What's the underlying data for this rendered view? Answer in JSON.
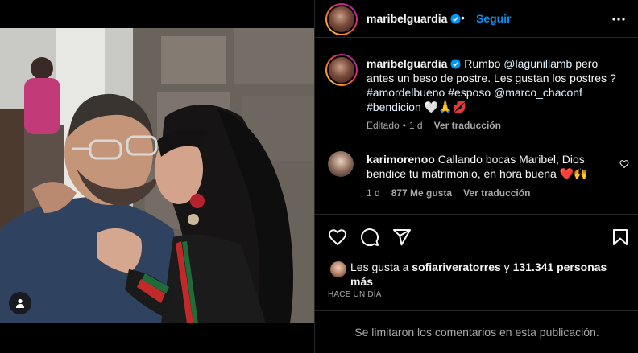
{
  "post": {
    "username": "maribelguardia",
    "separator": "•",
    "follow_label": "Seguir",
    "caption": {
      "username": "maribelguardia",
      "text_1": " Rumbo ",
      "mention_1": "@lagunillamb",
      "text_2": " pero antes un beso de postre. Les gustan los postres ? ",
      "hashtag_1": "#amordelbueno",
      "text_3": " ",
      "hashtag_2": "#esposo",
      "text_4": " ",
      "mention_2": "@marco_chaconf",
      "text_5": " ",
      "hashtag_3": "#bendicion",
      "emojis": " 🤍🙏💋"
    },
    "meta": {
      "edited": "Editado",
      "dot": "•",
      "age": "1 d",
      "translate": "Ver traducción"
    }
  },
  "comment": {
    "username": "karimorenoo",
    "text": " Callando bocas Maribel, Dios bendice tu matrimonio, en hora buena ❤️🙌",
    "age": "1 d",
    "likes": "877 Me gusta",
    "translate": "Ver traducción"
  },
  "likes": {
    "prefix": "Les gusta a ",
    "user": "sofiariveratorres",
    "middle": " y ",
    "count": "131.341 personas más"
  },
  "timestamp": "HACE UN DÍA",
  "comments_limited": "Se limitaron los comentarios en esta publicación.",
  "icons": {
    "verified": "verified-badge-icon",
    "more": "more-options-icon",
    "like": "heart-icon",
    "comment": "comment-icon",
    "share": "share-icon",
    "save": "bookmark-icon",
    "tag": "user-tag-icon"
  },
  "colors": {
    "accent": "#0095f6",
    "verified": "#0095f6",
    "muted": "#a8a8a8",
    "background": "#000000"
  }
}
